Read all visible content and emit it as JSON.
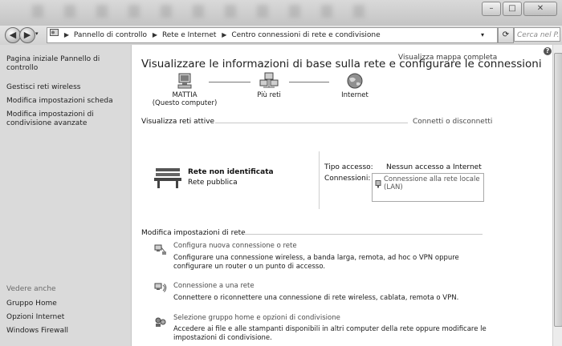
{
  "address": {
    "crumbs": [
      "Pannello di controllo",
      "Rete e Internet",
      "Centro connessioni di rete e condivisione"
    ],
    "search_placeholder": "Cerca nel P..."
  },
  "window_buttons": {
    "minimize": "–",
    "maximize": "□",
    "close": "✕"
  },
  "sidebar": {
    "items": [
      "Pagina iniziale Pannello di controllo",
      "Gestisci reti wireless",
      "Modifica impostazioni scheda",
      "Modifica impostazioni di condivisione avanzate"
    ],
    "see_also_title": "Vedere anche",
    "see_also": [
      "Gruppo Home",
      "Opzioni Internet",
      "Windows Firewall"
    ]
  },
  "main": {
    "title": "Visualizzare le informazioni di base sulla rete e configurare le connessioni",
    "full_map_link": "Visualizza mappa completa",
    "map": {
      "computer_name": "MATTIA",
      "computer_sub": "(Questo computer)",
      "middle": "Più reti",
      "internet": "Internet"
    },
    "active_networks": {
      "header": "Visualizza reti attive",
      "connect_link": "Connetti o disconnetti",
      "network_name": "Rete non identificata",
      "network_type": "Rete pubblica",
      "access_label": "Tipo accesso:",
      "access_value": "Nessun accesso a Internet",
      "connections_label": "Connessioni:",
      "connections_value": "Connessione alla rete locale (LAN)"
    },
    "settings": {
      "header": "Modifica impostazioni di rete",
      "tasks": [
        {
          "icon": "network-setup-icon",
          "link": "Configura nuova connessione o rete",
          "desc": "Configurare una connessione wireless, a banda larga, remota, ad hoc o VPN oppure configurare un router o un punto di accesso."
        },
        {
          "icon": "connect-network-icon",
          "link": "Connessione a una rete",
          "desc": "Connettere o riconnettere una connessione di rete wireless, cablata, remota o VPN."
        },
        {
          "icon": "homegroup-icon",
          "link": "Selezione gruppo home e opzioni di condivisione",
          "desc": "Accedere ai file e alle stampanti disponibili in altri computer della rete oppure modificare le impostazioni di condivisione."
        }
      ]
    }
  }
}
